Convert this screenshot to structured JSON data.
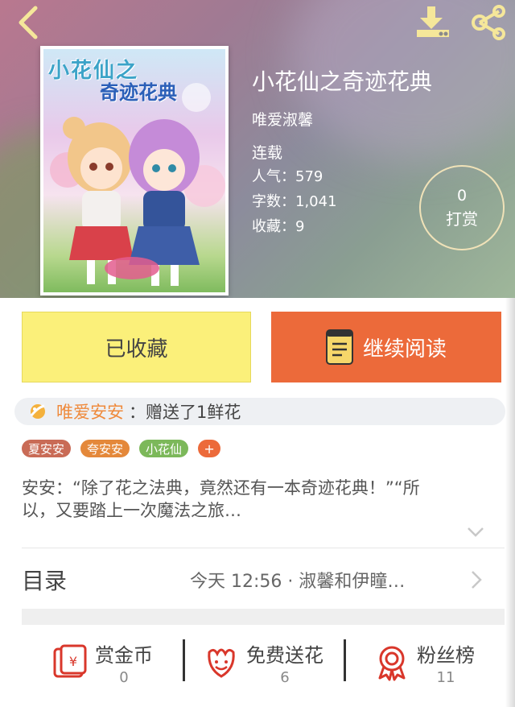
{
  "header": {
    "back_icon": "chevron-left-icon",
    "download_icon": "download-icon",
    "share_icon": "share-icon"
  },
  "cover": {
    "title_line1": "小花仙之",
    "title_line2": "奇迹花典"
  },
  "book": {
    "title": "小花仙之奇迹花典",
    "author": "唯爱淑馨",
    "status": "连载",
    "popularity": "人气：579",
    "word_count": "字数：1,041",
    "favorites": "收藏：9"
  },
  "reward": {
    "count": "0",
    "label": "打赏"
  },
  "buttons": {
    "collected": "已收藏",
    "continue_reading": "继续阅读"
  },
  "gift": {
    "user": "唯爱安安",
    "text": "：赠送了1鲜花"
  },
  "tags": [
    {
      "label": "夏安安",
      "color": "#c96b56"
    },
    {
      "label": "夸安安",
      "color": "#e4883a"
    },
    {
      "label": "小花仙",
      "color": "#7cb85a"
    }
  ],
  "tag_add": "+",
  "intro": "安安：“除了花之法典，竟然还有一本奇迹花典！”“所以，又要踏上一次魔法之旅…",
  "catalog": {
    "label": "目录",
    "latest": "今天 12:56 · 淑馨和伊瞳…"
  },
  "actions": [
    {
      "label": "赏金币",
      "value": "0",
      "icon": "red-envelope-icon"
    },
    {
      "label": "免费送花",
      "value": "6",
      "icon": "flower-icon"
    },
    {
      "label": "粉丝榜",
      "value": "11",
      "icon": "medal-icon"
    }
  ],
  "colors": {
    "accent": "#ec6a3a",
    "collected_bg": "#fbf07a",
    "gift_user": "#ef8a3c",
    "icon_red": "#d9372b"
  }
}
